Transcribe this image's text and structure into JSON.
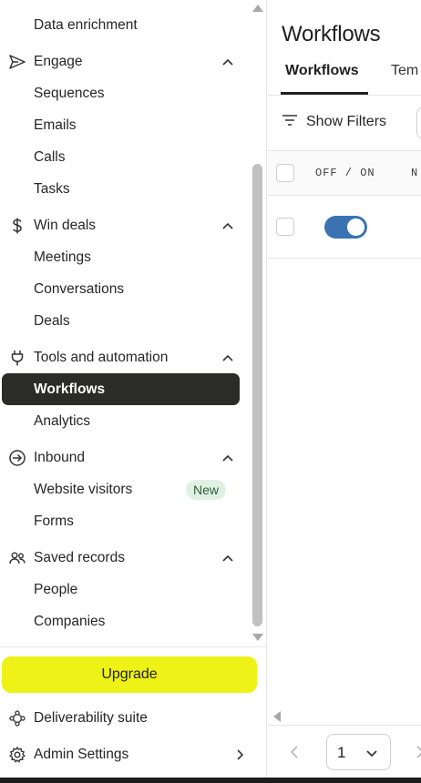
{
  "sidebar": {
    "top_item": {
      "label": "Data enrichment"
    },
    "groups": {
      "engage": {
        "label": "Engage",
        "icon": "send-icon",
        "items": [
          "Sequences",
          "Emails",
          "Calls",
          "Tasks"
        ]
      },
      "win_deals": {
        "label": "Win deals",
        "icon": "dollar-icon",
        "items": [
          "Meetings",
          "Conversations",
          "Deals"
        ]
      },
      "tools": {
        "label": "Tools and automation",
        "icon": "plug-icon",
        "items": [
          "Workflows",
          "Analytics"
        ],
        "active": "Workflows"
      },
      "inbound": {
        "label": "Inbound",
        "icon": "enter-arrow-icon",
        "items": [
          "Website visitors",
          "Forms"
        ],
        "badge": "New"
      },
      "saved": {
        "label": "Saved records",
        "icon": "people-icon",
        "items": [
          "People",
          "Companies"
        ]
      }
    },
    "upgrade_label": "Upgrade",
    "footer": {
      "deliverability": "Deliverability suite",
      "admin": "Admin Settings"
    }
  },
  "main": {
    "title": "Workflows",
    "tabs": [
      "Workflows",
      "Tem"
    ],
    "show_filters": "Show Filters",
    "table": {
      "col_toggle": "OFF / ON",
      "col_name": "N",
      "rows": [
        {
          "toggle_on": true
        }
      ]
    },
    "pagination": {
      "page": "1"
    }
  },
  "colors": {
    "active_nav_bg": "#2b2b29",
    "upgrade_bg": "#eef216",
    "toggle_on": "#3b73b2",
    "badge_bg": "#dff1e3"
  }
}
